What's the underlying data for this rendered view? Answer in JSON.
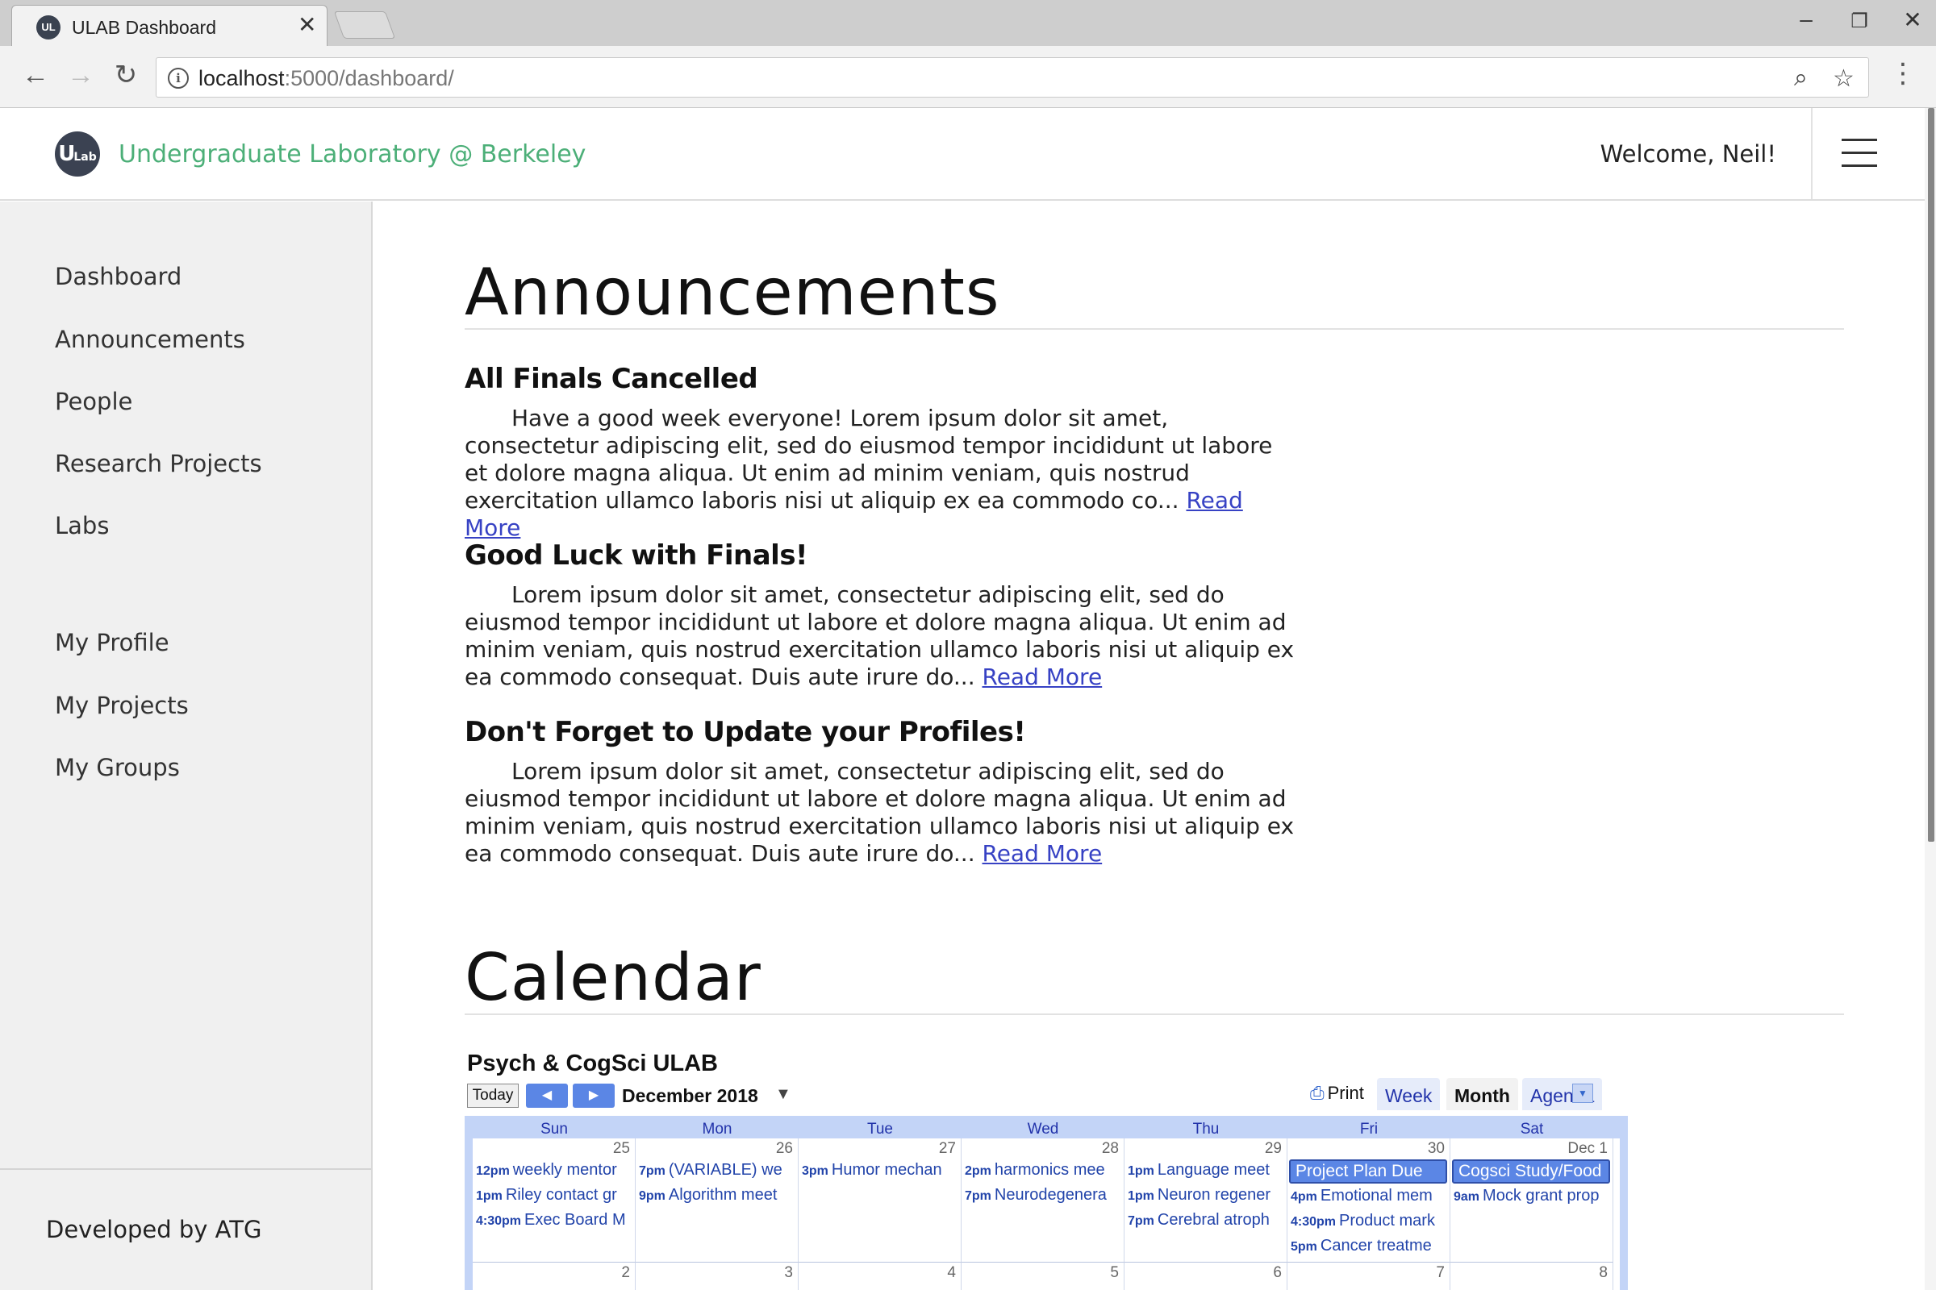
{
  "browser": {
    "tab_title": "ULAB Dashboard",
    "tab_favicon_text": "UL",
    "close_glyph": "✕",
    "url_host": "localhost",
    "url_path": ":5000/dashboard/",
    "icons": [
      "back-arrow-icon",
      "forward-arrow-icon",
      "reload-icon",
      "info-icon",
      "zoom-icon",
      "star-icon",
      "menu-dots-icon",
      "minimize-icon",
      "restore-icon",
      "close-icon"
    ]
  },
  "header": {
    "logo_text": "U",
    "logo_small": "Lab",
    "site_name": "Undergraduate Laboratory @ Berkeley",
    "welcome": "Welcome, Neil!"
  },
  "sidebar": {
    "items": [
      {
        "label": "Dashboard"
      },
      {
        "label": "Announcements"
      },
      {
        "label": "People"
      },
      {
        "label": "Research Projects"
      },
      {
        "label": "Labs"
      },
      {
        "label": "My Profile"
      },
      {
        "label": "My Projects"
      },
      {
        "label": "My Groups"
      }
    ],
    "footer": "Developed by ATG"
  },
  "announcements": {
    "title": "Announcements",
    "read_more": "Read More",
    "items": [
      {
        "title": "All Finals Cancelled",
        "body": "Have a good week everyone! Lorem ipsum dolor sit amet, consectetur adipiscing elit, sed do eiusmod tempor incididunt ut labore et dolore magna aliqua. Ut enim ad minim veniam, quis nostrud exercitation ullamco laboris nisi ut aliquip ex ea commodo co... "
      },
      {
        "title": "Good Luck with Finals!",
        "body": "Lorem ipsum dolor sit amet, consectetur adipiscing elit, sed do eiusmod tempor incididunt ut labore et dolore magna aliqua. Ut enim ad minim veniam, quis nostrud exercitation ullamco laboris nisi ut aliquip ex ea commodo consequat. Duis aute irure do... "
      },
      {
        "title": "Don't Forget to Update your Profiles!",
        "body": "Lorem ipsum dolor sit amet, consectetur adipiscing elit, sed do eiusmod tempor incididunt ut labore et dolore magna aliqua. Ut enim ad minim veniam, quis nostrud exercitation ullamco laboris nisi ut aliquip ex ea commodo consequat. Duis aute irure do... "
      }
    ]
  },
  "calendar": {
    "section_title": "Calendar",
    "name": "Psych & CogSci ULAB",
    "today_label": "Today",
    "prev_glyph": "◀",
    "next_glyph": "▶",
    "month_label": "December 2018",
    "dropdown_glyph": "▼",
    "print_label": "Print",
    "views": [
      "Week",
      "Month",
      "Agenda"
    ],
    "active_view": "Month",
    "days_of_week": [
      "Sun",
      "Mon",
      "Tue",
      "Wed",
      "Thu",
      "Fri",
      "Sat"
    ],
    "week1": [
      {
        "num": "25",
        "events": [
          {
            "time": "12pm",
            "text": "weekly mentor"
          },
          {
            "time": "1pm",
            "text": "Riley contact gr"
          },
          {
            "time": "4:30pm",
            "text": "Exec Board M"
          }
        ]
      },
      {
        "num": "26",
        "events": [
          {
            "time": "7pm",
            "text": "(VARIABLE) we"
          },
          {
            "time": "9pm",
            "text": "Algorithm meet"
          }
        ]
      },
      {
        "num": "27",
        "events": [
          {
            "time": "3pm",
            "text": "Humor mechan"
          }
        ]
      },
      {
        "num": "28",
        "events": [
          {
            "time": "2pm",
            "text": "harmonics mee"
          },
          {
            "time": "7pm",
            "text": "Neurodegenera"
          }
        ]
      },
      {
        "num": "29",
        "events": [
          {
            "time": "1pm",
            "text": "Language meet"
          },
          {
            "time": "1pm",
            "text": "Neuron regener"
          },
          {
            "time": "7pm",
            "text": "Cerebral atroph"
          }
        ]
      },
      {
        "num": "30",
        "allday": "Project Plan Due",
        "events": [
          {
            "time": "4pm",
            "text": "Emotional mem"
          },
          {
            "time": "4:30pm",
            "text": "Product mark"
          },
          {
            "time": "5pm",
            "text": "Cancer treatme"
          }
        ]
      },
      {
        "num": "Dec 1",
        "allday": "Cogsci Study/Food",
        "events": [
          {
            "time": "9am",
            "text": "Mock grant prop"
          }
        ]
      }
    ],
    "week2_nums": [
      "2",
      "3",
      "4",
      "5",
      "6",
      "7",
      "8"
    ]
  }
}
